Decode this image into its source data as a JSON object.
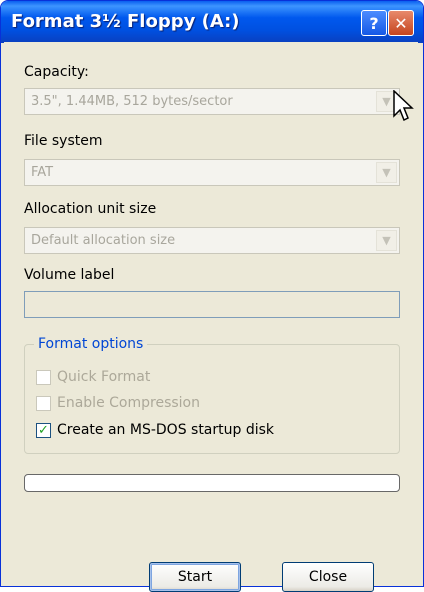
{
  "window": {
    "title": "Format 3½ Floppy (A:)",
    "help_label": "?",
    "close_label": "✕"
  },
  "capacity": {
    "label": "Capacity:",
    "value": "3.5\",  1.44MB, 512 bytes/sector"
  },
  "file_system": {
    "label": "File system",
    "value": "FAT"
  },
  "allocation": {
    "label": "Allocation unit size",
    "value": "Default allocation size"
  },
  "volume": {
    "label": "Volume label",
    "value": ""
  },
  "format_options": {
    "legend": "Format options",
    "quick_format": {
      "label": "Quick Format",
      "checked": false,
      "enabled": false
    },
    "enable_compression": {
      "label": "Enable Compression",
      "checked": false,
      "enabled": false
    },
    "msdos_startup": {
      "label": "Create an MS-DOS startup disk",
      "checked": true,
      "enabled": true
    }
  },
  "progress": {
    "value": 0
  },
  "buttons": {
    "start": "Start",
    "close": "Close"
  },
  "colors": {
    "title_bar": "#0058ee",
    "dialog_bg": "#ece9d8",
    "group_legend": "#0046d5",
    "check_mark": "#21a121"
  }
}
